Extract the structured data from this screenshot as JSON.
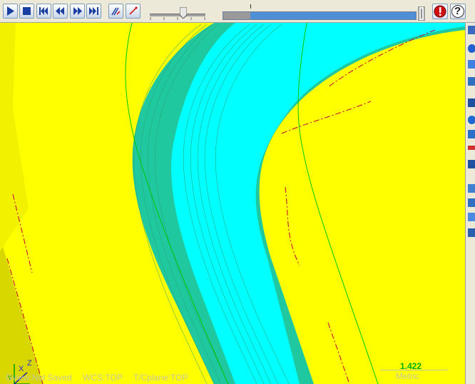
{
  "toolbar": {
    "buttons": [
      {
        "name": "play-button",
        "icon": "play-icon"
      },
      {
        "name": "stop-button",
        "icon": "stop-icon"
      },
      {
        "name": "rewind-start-button",
        "icon": "skip-start-icon"
      },
      {
        "name": "step-back-button",
        "icon": "step-back-icon"
      },
      {
        "name": "step-forward-button",
        "icon": "step-forward-icon"
      },
      {
        "name": "skip-end-button",
        "icon": "skip-end-icon"
      },
      {
        "name": "toolpath-display-button",
        "icon": "toolpath-icon"
      },
      {
        "name": "tool-display-button",
        "icon": "tool-icon"
      }
    ],
    "speed_slider_level": 0.6,
    "progress_level": 0.14,
    "stop_icon": "red-stop-icon",
    "help_label": "?"
  },
  "status": {
    "gview": "Gview:Not Saved",
    "wcs": "WCS:TOP",
    "tcplane": "T/Cplane:TOP"
  },
  "scale": {
    "value": "1.422",
    "unit": "Metric"
  },
  "axis": {
    "x": "X",
    "y": "Y",
    "z": "Z"
  },
  "colors": {
    "stock": "#ffff00",
    "toolpath": "#00ffff",
    "boundary": "#00c800",
    "contour": "#c00040"
  }
}
